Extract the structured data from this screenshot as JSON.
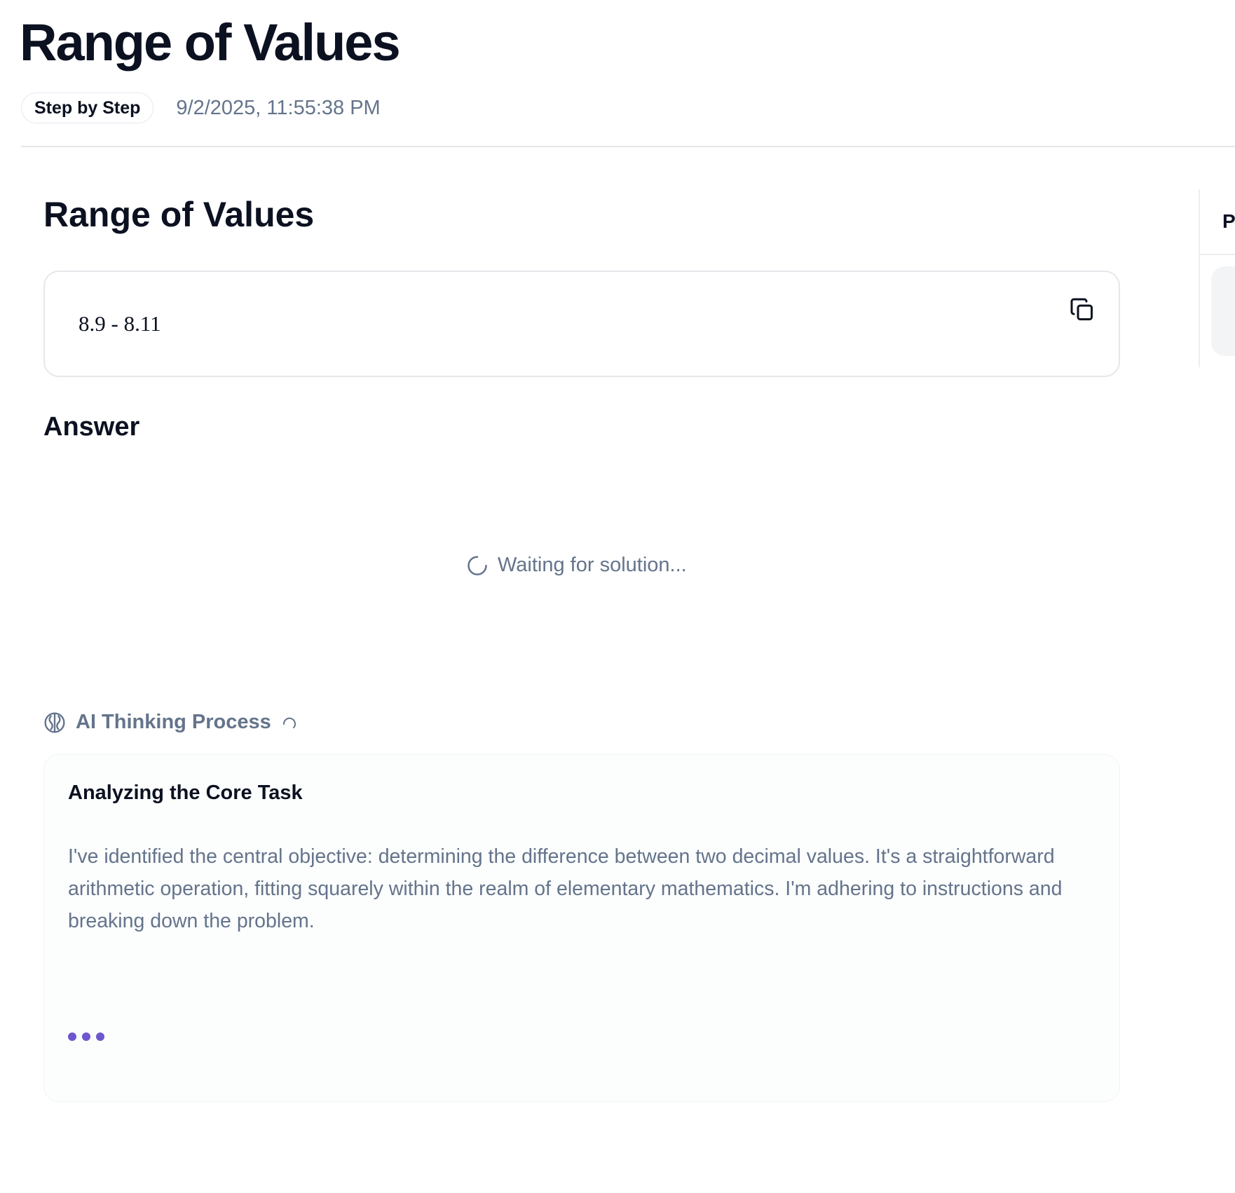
{
  "header": {
    "title": "Range of Values",
    "mode_badge": "Step by Step",
    "timestamp": "9/2/2025, 11:55:38 PM"
  },
  "problem": {
    "title": "Range of Values",
    "expression": "8.9 - 8.11",
    "copy_icon": "copy-icon"
  },
  "answer": {
    "heading": "Answer",
    "status": "Waiting for solution...",
    "status_icon": "spinner-icon"
  },
  "thinking": {
    "heading": "AI Thinking Process",
    "heading_icon": "brain-icon",
    "loading_icon": "spinner-icon",
    "step_title": "Analyzing the Core Task",
    "body": "I've identified the central objective: determining the difference between two decimal values. It's a straightforward arithmetic operation, fitting squarely within the realm of elementary mathematics. I'm adhering to instructions and breaking down the problem.",
    "typing_indicator_color": "#6e56cf"
  },
  "side_panel": {
    "tab_label": "P"
  }
}
